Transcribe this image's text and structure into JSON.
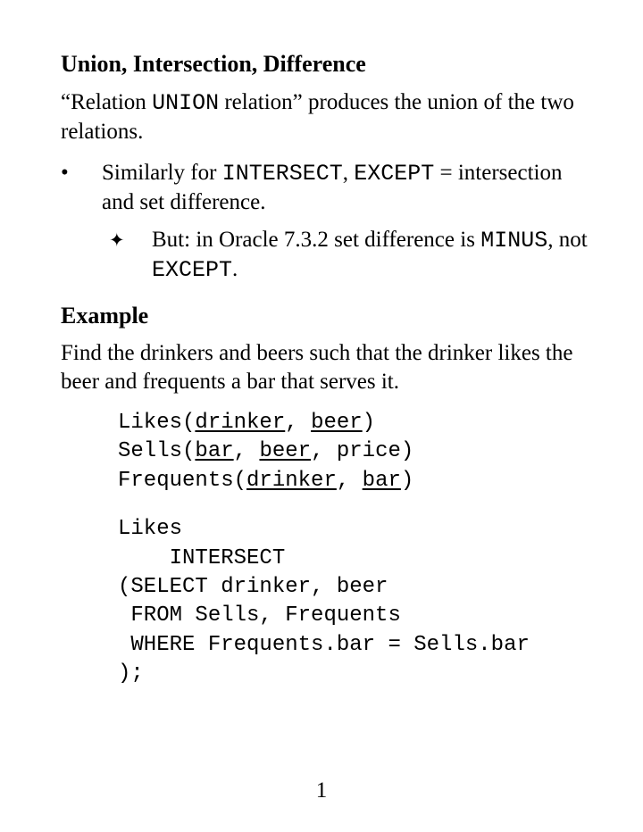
{
  "title": "Union, Intersection, Difference",
  "intro": {
    "before_code": "“Relation ",
    "code": "UNION",
    "after_code": " relation” produces the union of the two relations."
  },
  "bullet": {
    "text_before": "Similarly for ",
    "code1": "INTERSECT",
    "mid1": ", ",
    "code2": "EXCEPT",
    "after": " = intersection and set difference."
  },
  "subbullet": {
    "text_before": "But: in Oracle 7.3.2 set difference is ",
    "code1": "MINUS",
    "mid1": ", not ",
    "code2": "EXCEPT",
    "after": "."
  },
  "example_heading": "Example",
  "example_text": "Find the drinkers and beers such that the drinker likes the beer and frequents a bar that serves it.",
  "schema": {
    "likes": {
      "rel": "Likes",
      "a1": "drinker",
      "a2": "beer"
    },
    "sells": {
      "rel": "Sells",
      "a1": "bar",
      "a2": "beer",
      "a3": "price"
    },
    "frequents": {
      "rel": "Frequents",
      "a1": "drinker",
      "a2": "bar"
    }
  },
  "query": {
    "l1": "Likes",
    "l2": "    INTERSECT",
    "l3": "(SELECT drinker, beer",
    "l4": " FROM Sells, Frequents",
    "l5": " WHERE Frequents.bar = Sells.bar",
    "l6": ");"
  },
  "page_number": "1"
}
